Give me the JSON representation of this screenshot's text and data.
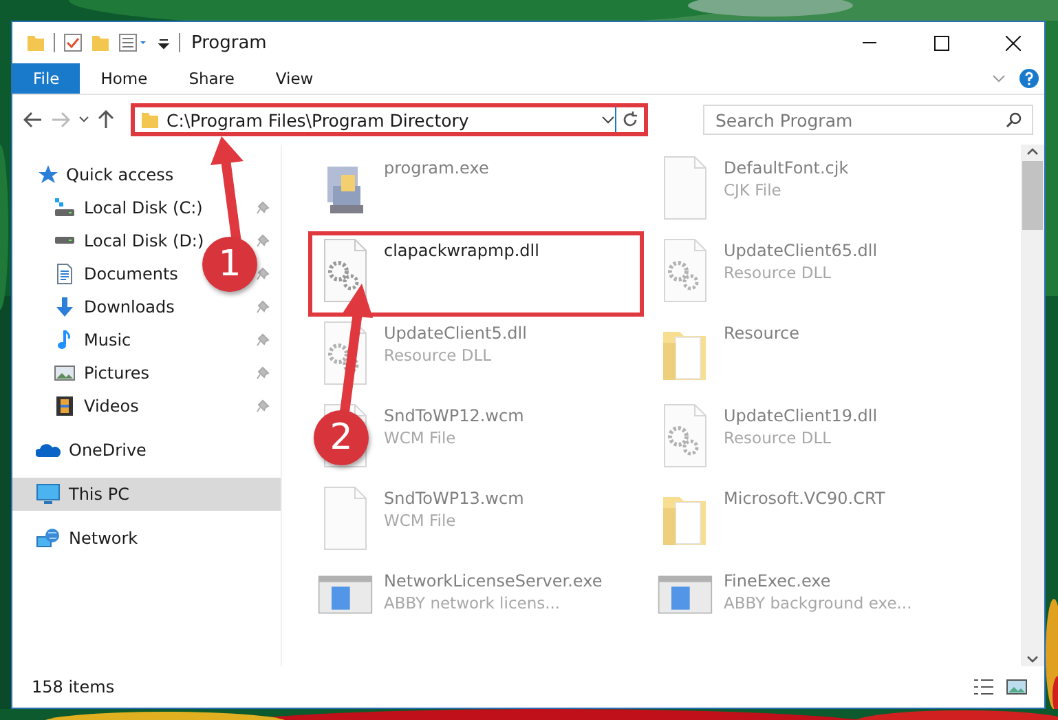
{
  "window": {
    "title": "Program"
  },
  "ribbon": {
    "tabs": [
      {
        "label": "File",
        "kind": "file",
        "selected": false
      },
      {
        "label": "Home",
        "kind": "tab",
        "selected": false
      },
      {
        "label": "Share",
        "kind": "tab",
        "selected": false
      },
      {
        "label": "View",
        "kind": "tab",
        "selected": false
      }
    ]
  },
  "address_bar": {
    "path": "C:\\Program Files\\Program Directory",
    "marked": true
  },
  "search": {
    "placeholder": "Search Program"
  },
  "sidebar": {
    "items": [
      {
        "label": "Quick access",
        "kind": "star",
        "selected": false,
        "children": [
          {
            "label": "Local Disk (C:)",
            "kind": "disk-c",
            "pinned": true,
            "selected": false
          },
          {
            "label": "Local Disk (D:)",
            "kind": "disk",
            "pinned": true,
            "selected": false
          },
          {
            "label": "Documents",
            "kind": "documents",
            "pinned": true,
            "selected": false
          },
          {
            "label": "Downloads",
            "kind": "downloads",
            "pinned": true,
            "selected": false
          },
          {
            "label": "Music",
            "kind": "music",
            "pinned": true,
            "selected": false
          },
          {
            "label": "Pictures",
            "kind": "pictures",
            "pinned": true,
            "selected": false
          },
          {
            "label": "Videos",
            "kind": "videos",
            "pinned": true,
            "selected": false
          }
        ]
      },
      {
        "label": "OneDrive",
        "kind": "cloud",
        "selected": false
      },
      {
        "label": "This PC",
        "kind": "pc",
        "selected": true
      },
      {
        "label": "Network",
        "kind": "network",
        "selected": false
      }
    ]
  },
  "files": [
    {
      "name": "program.exe",
      "kind": "app",
      "marked": false
    },
    {
      "name": "DefaultFont.cjk",
      "type": "CJK File",
      "kind": "doc",
      "marked": false
    },
    {
      "name": "clapackwrapmp.dll",
      "kind": "dll",
      "marked": true
    },
    {
      "name": "UpdateClient65.dll",
      "type": "Resource DLL",
      "kind": "dll",
      "marked": false
    },
    {
      "name": "UpdateClient5.dll",
      "type": "Resource DLL",
      "kind": "dll",
      "marked": false
    },
    {
      "name": "Resource",
      "kind": "folder",
      "marked": false
    },
    {
      "name": "SndToWP12.wcm",
      "type": "WCM File",
      "kind": "doc",
      "marked": false
    },
    {
      "name": "UpdateClient19.dll",
      "type": "Resource DLL",
      "kind": "dll",
      "marked": false
    },
    {
      "name": "SndToWP13.wcm",
      "type": "WCM File",
      "kind": "doc",
      "marked": false
    },
    {
      "name": "Microsoft.VC90.CRT",
      "kind": "folder",
      "marked": false
    },
    {
      "name": "NetworkLicenseServer.exe",
      "type": "ABBY network licens...",
      "kind": "exe",
      "marked": false
    },
    {
      "name": "FineExec.exe",
      "type": "ABBY background exe...",
      "kind": "exe",
      "marked": false
    }
  ],
  "status_bar": {
    "count": "158 items"
  },
  "annotations": [
    {
      "label": "1"
    },
    {
      "label": "2"
    }
  ]
}
